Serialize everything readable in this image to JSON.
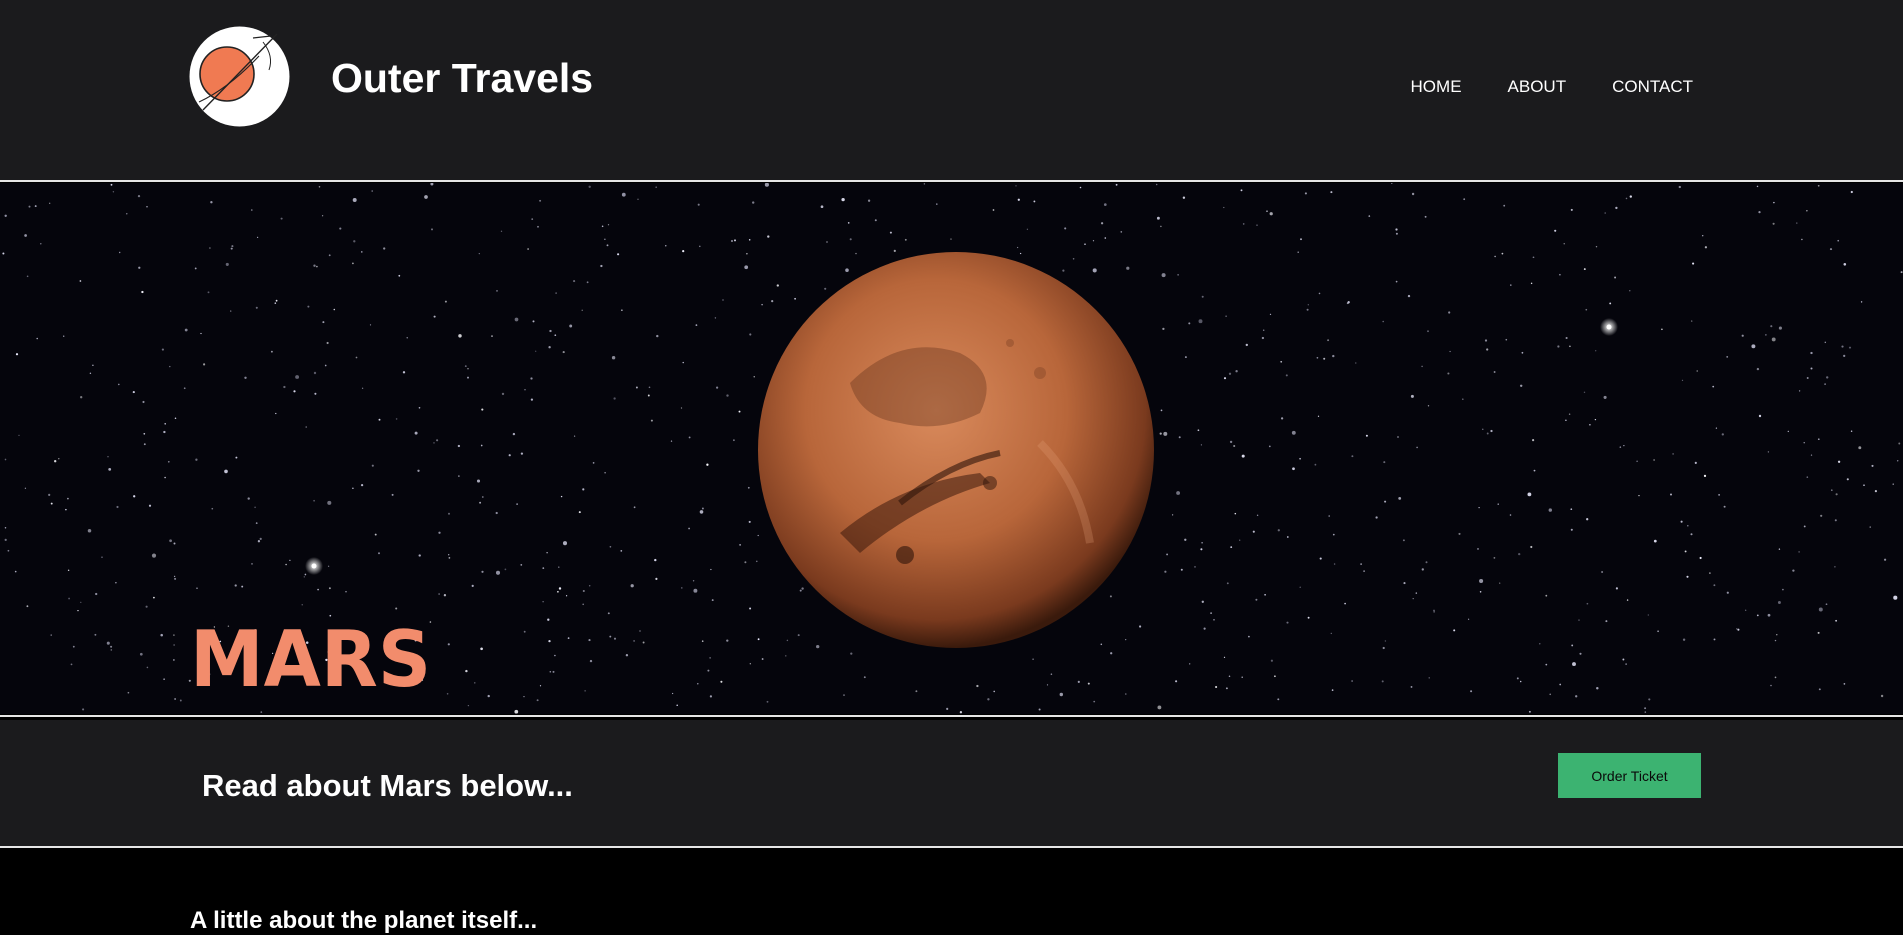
{
  "header": {
    "site_title": "Outer Travels",
    "logo_icon": "planet-orbit-logo-icon"
  },
  "nav": {
    "items": [
      {
        "label": "HOME"
      },
      {
        "label": "ABOUT"
      },
      {
        "label": "CONTACT"
      }
    ]
  },
  "hero": {
    "planet_name": "MARS",
    "planet_color": "#c2683a",
    "title_color": "#f28c6c"
  },
  "subbar": {
    "title": "Read about Mars below...",
    "order_button_label": "Order Ticket",
    "button_color": "#3cb371"
  },
  "about": {
    "heading": "A little about the planet itself..."
  }
}
